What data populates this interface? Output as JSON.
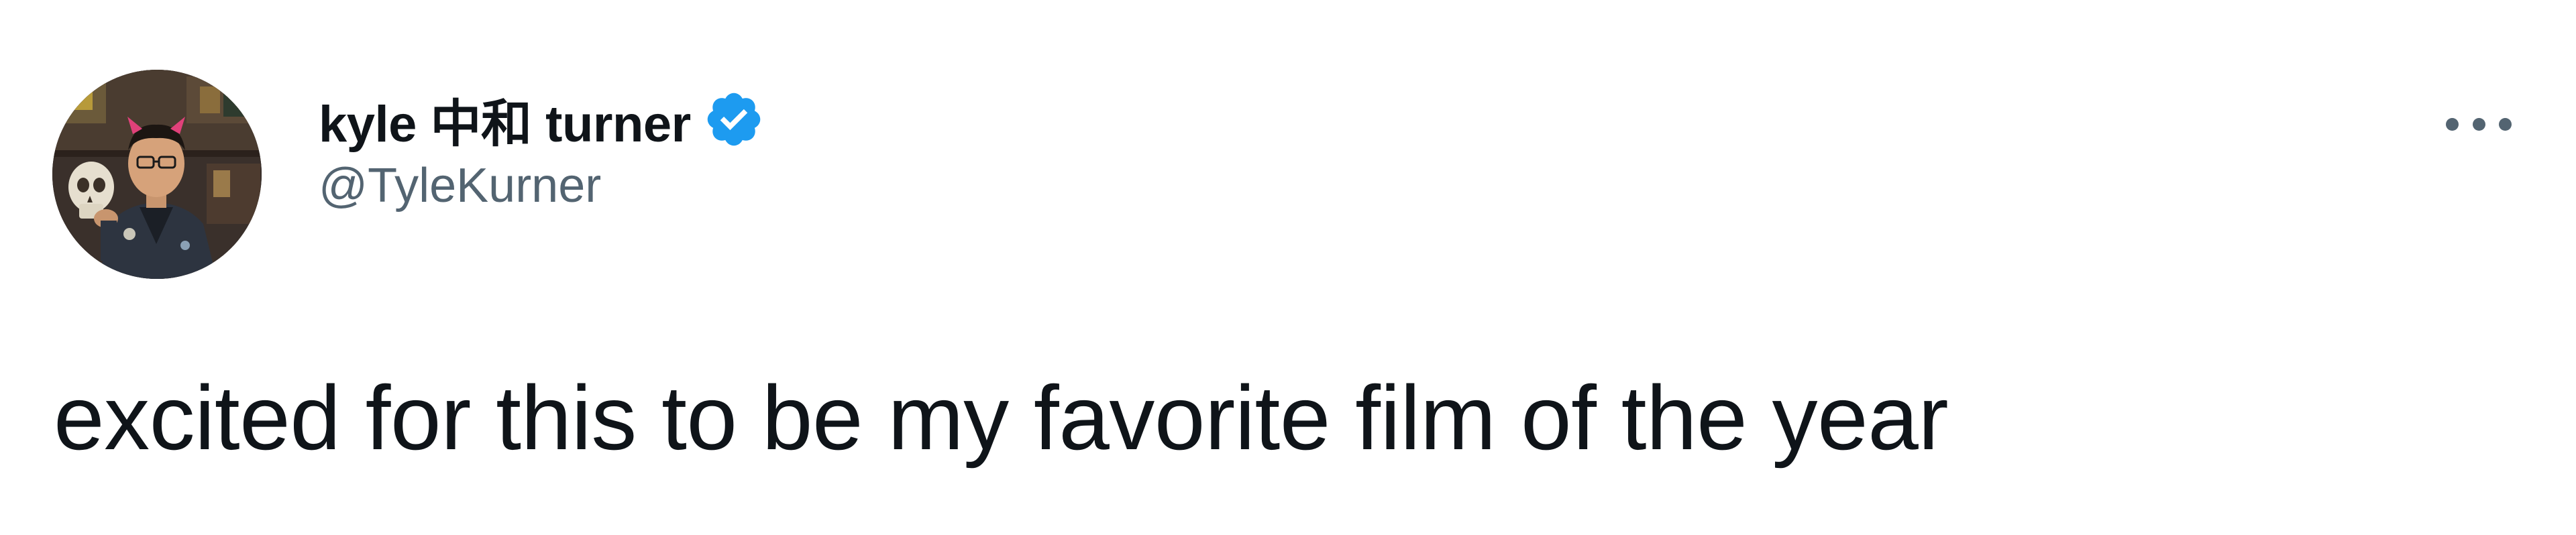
{
  "tweet": {
    "author": {
      "display_name": "kyle 中和 turner",
      "handle": "@TyleKurner",
      "verified": true,
      "avatar_icon": "profile-photo"
    },
    "text": "excited for this to be my favorite film of the year",
    "more_icon": "more-options-icon"
  },
  "colors": {
    "text_primary": "#0f1419",
    "text_secondary": "#536471",
    "verified_blue": "#1d9bf0",
    "background": "#ffffff"
  }
}
